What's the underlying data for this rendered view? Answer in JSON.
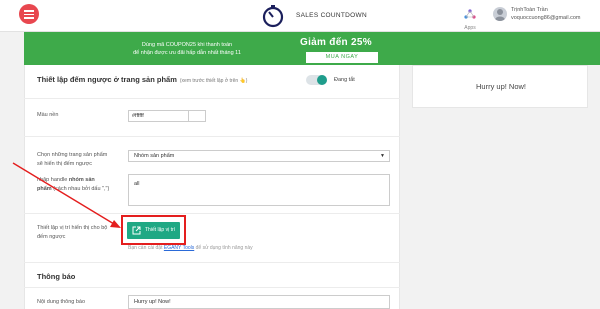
{
  "header": {
    "app_title": "SALES COUNTDOWN",
    "apps_label": "Apps",
    "user_name": "TrịnhToàn Trần",
    "user_email": "voquoccuong86@gmail.com"
  },
  "banner": {
    "text_line1": "Dùng mã COUPON25 khi thanh toán",
    "text_line2": "để nhận được ưu đãi hấp dẫn nhất tháng 11",
    "headline": "Giảm đến 25%",
    "button_label": "MUA NGAY"
  },
  "preview": {
    "text": "Hurry up! Now!"
  },
  "settings": {
    "title": "Thiết lập đếm ngược ở trang sản phẩm",
    "title_note": "(xem trước thiết lập ở trên 👆)",
    "toggle_label": "Đang tắt",
    "toggle_on": true,
    "color_label": "Màu nền",
    "color_value": "#ffffff",
    "products_label_line1": "Chọn những trang sản phẩm",
    "products_label_line2": "sẽ hiển thị đếm ngược",
    "products_value": "Nhóm sản phẩm",
    "handle_label_prefix": "nhập handle ",
    "handle_label_bold1": "nhóm sản",
    "handle_label_bold2": "phẩm",
    "handle_label_suffix": " (cách nhau bởi dấu \",\")",
    "handle_value": "all",
    "position_label_line1": "Thiết lập vị trí hiển thị cho bộ",
    "position_label_line2": "đếm ngược",
    "position_button": "Thiết lập vị trí",
    "hint_prefix": "Bạn cần cài đặt ",
    "hint_link": "EGANY Tools",
    "hint_suffix": " để sử dụng tính năng này"
  },
  "notification": {
    "title": "Thông báo",
    "content_label": "Nội dung thông báo",
    "content_value": "Hurry up! Now!"
  },
  "colors": {
    "accent_green": "#3eaa4a",
    "button_teal": "#1fa884",
    "annotation_red": "#e41e1e",
    "menu_red": "#e8474f"
  }
}
